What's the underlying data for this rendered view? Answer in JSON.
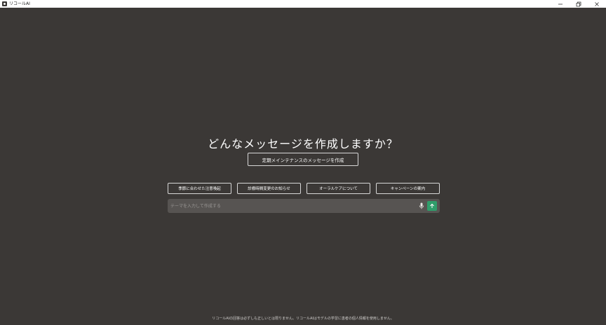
{
  "window": {
    "title": "リコールAI",
    "minimize_label": "—",
    "maximize_label": "⧉",
    "close_label": "✕"
  },
  "main": {
    "heading": "どんなメッセージを作成しますか？",
    "primary_button": "定期メインテナンスのメッセージを作成",
    "suggestions": [
      "季節に合わせた注意喚起",
      "診療時間変更のお知らせ",
      "オーラルケアについて",
      "キャンペーンの案内"
    ]
  },
  "input": {
    "placeholder": "テーマを入力して作成する",
    "value": ""
  },
  "footer": {
    "disclaimer": "リコールAIの回答は必ずしも正しいとは限りません。リコールAIはモデルの学習に患者の個人情報を使用しません。"
  },
  "colors": {
    "background": "#3b3836",
    "input_background": "#575452",
    "send_button": "#2f9e6b"
  },
  "icons": {
    "mic": "microphone-icon",
    "send": "arrow-up-icon"
  }
}
